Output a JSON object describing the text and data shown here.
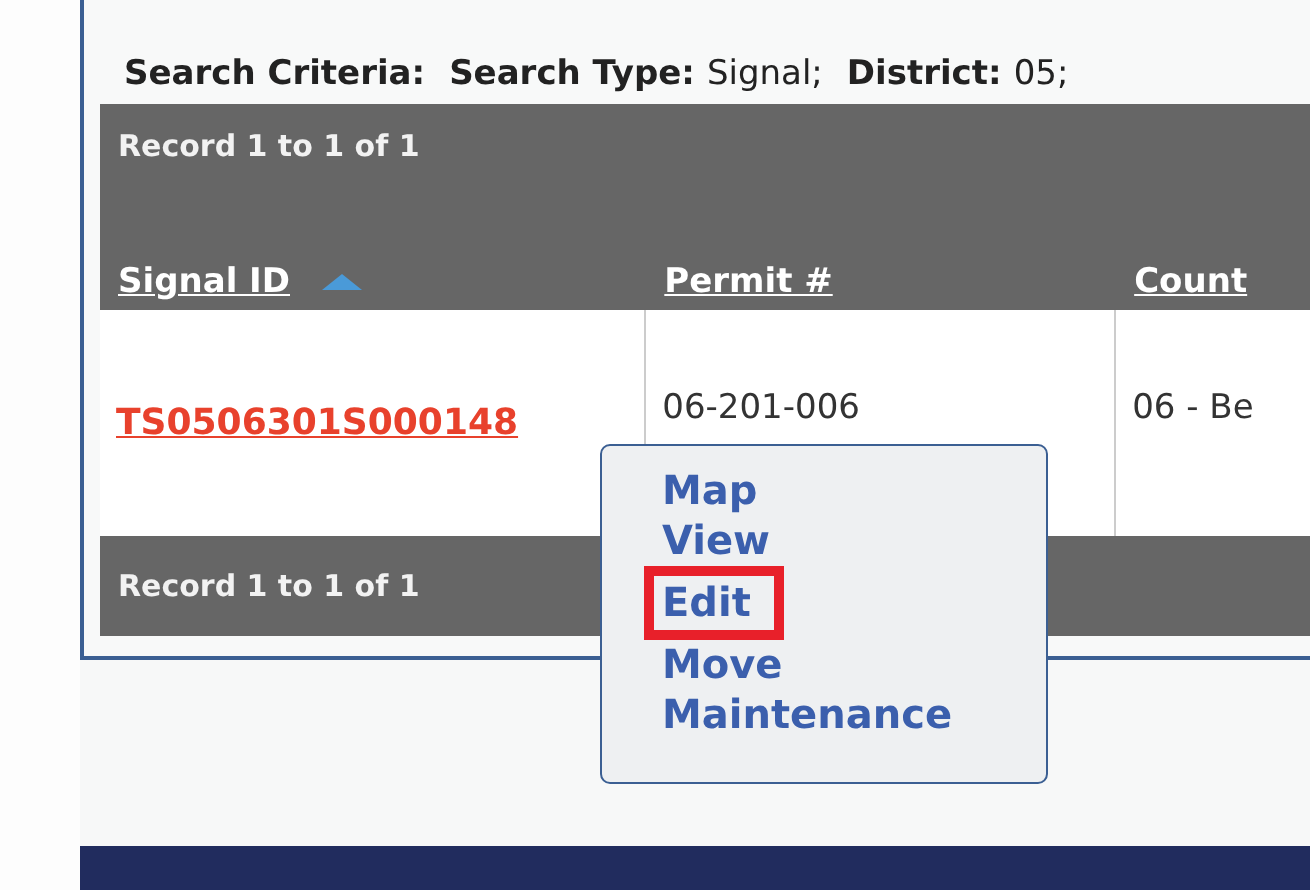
{
  "search_criteria": {
    "label": "Search Criteria:",
    "items": [
      {
        "label": "Search Type:",
        "value": "Signal;"
      },
      {
        "label": "District:",
        "value": "05;"
      }
    ]
  },
  "table": {
    "pager_top": "Record 1 to 1 of 1",
    "columns": [
      {
        "label": "Signal ID",
        "sorted": true
      },
      {
        "label": "Permit #",
        "sorted": false
      },
      {
        "label": "Count",
        "sorted": false
      }
    ],
    "rows": [
      [
        "TS0506301S000148",
        "06-201-006",
        "06 - Be"
      ]
    ],
    "pager_bottom": "Record 1 to 1 of 1"
  },
  "context_menu": {
    "items": [
      {
        "label": "Map",
        "highlighted": false
      },
      {
        "label": "View",
        "highlighted": false
      },
      {
        "label": "Edit",
        "highlighted": true
      },
      {
        "label": "Move",
        "highlighted": false
      },
      {
        "label": "Maintenance",
        "highlighted": false
      }
    ]
  }
}
